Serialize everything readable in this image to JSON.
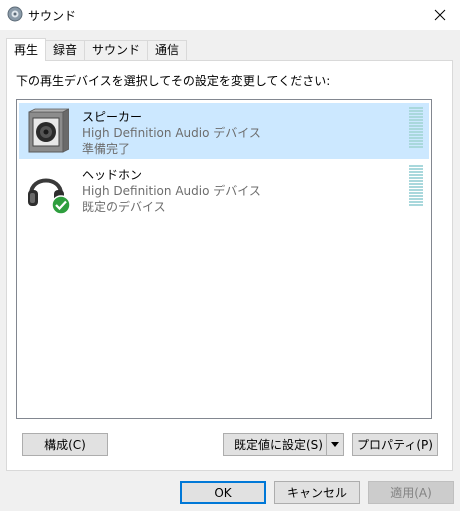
{
  "window": {
    "title": "サウンド",
    "icon": "speaker-app-icon",
    "close_icon": "close-icon"
  },
  "tabs": [
    {
      "label": "再生",
      "active": true
    },
    {
      "label": "録音",
      "active": false
    },
    {
      "label": "サウンド",
      "active": false
    },
    {
      "label": "通信",
      "active": false
    }
  ],
  "playback": {
    "instruction": "下の再生デバイスを選択してその設定を変更してください:",
    "devices": [
      {
        "name": "スピーカー",
        "description": "High Definition Audio デバイス",
        "status": "準備完了",
        "icon": "speaker-device-icon",
        "selected": true
      },
      {
        "name": "ヘッドホン",
        "description": "High Definition Audio デバイス",
        "status": "既定のデバイス",
        "icon": "headphones-device-icon",
        "badge_icon": "default-check-icon",
        "selected": false
      }
    ],
    "configure_label": "構成(C)",
    "set_default_label": "既定値に設定(S)",
    "properties_label": "プロパティ(P)"
  },
  "footer": {
    "ok_label": "OK",
    "cancel_label": "キャンセル",
    "apply_label": "適用(A)"
  },
  "colors": {
    "selection": "#cce8ff",
    "meter": "#a9d8dc",
    "accent": "#0078d7",
    "check_badge": "#2e9e3e"
  }
}
